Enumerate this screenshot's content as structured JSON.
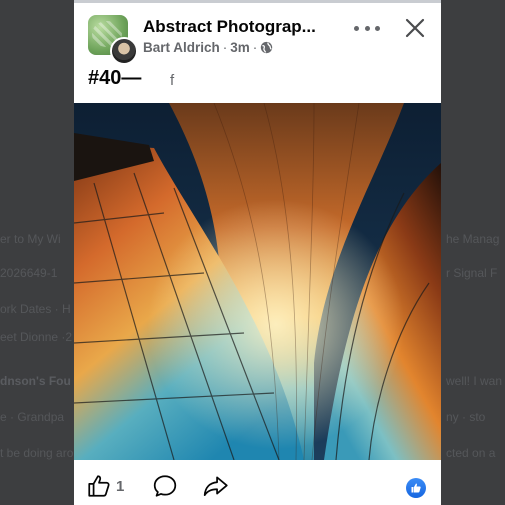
{
  "background": {
    "fragments": [
      "er to My Wi",
      "2026649-1",
      "ork Dates · H",
      "eet Dionne ·2",
      "dnson's Fou",
      "e · Grandpa",
      "t be doing aro",
      "he Manag",
      "r Signal F",
      "well! I wan",
      "ny · sto",
      "cted on a"
    ]
  },
  "post": {
    "page_name": "Abstract Photograp...",
    "author": "Bart Aldrich",
    "separator": "·",
    "time": "3m",
    "caption": "#40—",
    "caption_glyph": "f",
    "privacy_icon": "globe-icon",
    "like_count": "1",
    "reaction_icon": "like-reaction-icon"
  },
  "colors": {
    "accent": "#1877f2",
    "text_primary": "#050505",
    "text_secondary": "#65676b",
    "card_bg": "#ffffff",
    "page_bg": "#3d3e40"
  }
}
